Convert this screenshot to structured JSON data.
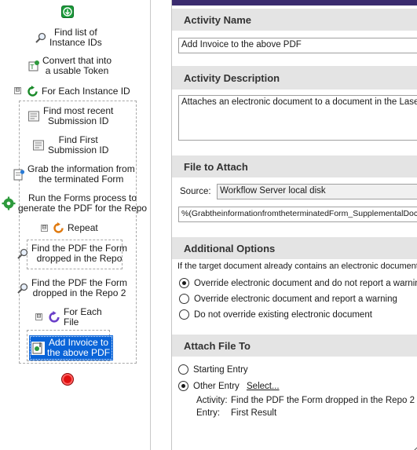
{
  "tree": {
    "nodes": [
      {
        "label": "Find list of\nInstance IDs"
      },
      {
        "label": "Convert that into\na usable Token"
      },
      {
        "label": "For Each Instance ID"
      },
      {
        "label": "Find most recent\nSubmission ID"
      },
      {
        "label": "Find First\nSubmission ID"
      },
      {
        "label": "Grab the information from\nthe terminated Form"
      },
      {
        "label": "Run the Forms process to\ngenerate the PDF for the Repo"
      },
      {
        "label": "Repeat"
      },
      {
        "label": "Find the PDF the Form\ndropped in the Repo"
      },
      {
        "label": "Find the PDF the Form\ndropped in the Repo 2"
      },
      {
        "label": "For Each\nFile"
      },
      {
        "label": "Add Invoice to\nthe above PDF"
      }
    ],
    "expander_symbol": "⊟"
  },
  "panel": {
    "activity_name": {
      "heading": "Activity Name",
      "value": "Add Invoice to the above PDF"
    },
    "activity_description": {
      "heading": "Activity Description",
      "value": "Attaches an electronic document to a document in the Laserfich"
    },
    "file_to_attach": {
      "heading": "File to Attach",
      "source_label": "Source:",
      "source_value": "Workflow Server local disk",
      "path_value": "%(GrabtheinformationfromtheterminatedForm_SupplementalDocs"
    },
    "additional_options": {
      "heading": "Additional Options",
      "prompt": "If the target document already contains an electronic document:",
      "options": [
        {
          "label": "Override electronic document and do not report a warning",
          "selected": true
        },
        {
          "label": "Override electronic document and report a warning",
          "selected": false
        },
        {
          "label": "Do not override existing electronic document",
          "selected": false
        }
      ]
    },
    "attach_file_to": {
      "heading": "Attach File To",
      "options": [
        {
          "label": "Starting Entry",
          "selected": false
        },
        {
          "label": "Other Entry",
          "selected": true
        }
      ],
      "select_link": "Select...",
      "activity_label": "Activity:",
      "activity_value": "Find the PDF the Form dropped in the Repo 2",
      "entry_label": "Entry:",
      "entry_value": "First Result"
    }
  },
  "colors": {
    "selection": "#0a64d8",
    "section_header": "#e4e4e4",
    "start_green": "#1a9c3a",
    "end_red": "#e01010",
    "link": "#0645c8",
    "loop_purple": "#6a3fc8",
    "repeat_orange": "#e07a10"
  }
}
